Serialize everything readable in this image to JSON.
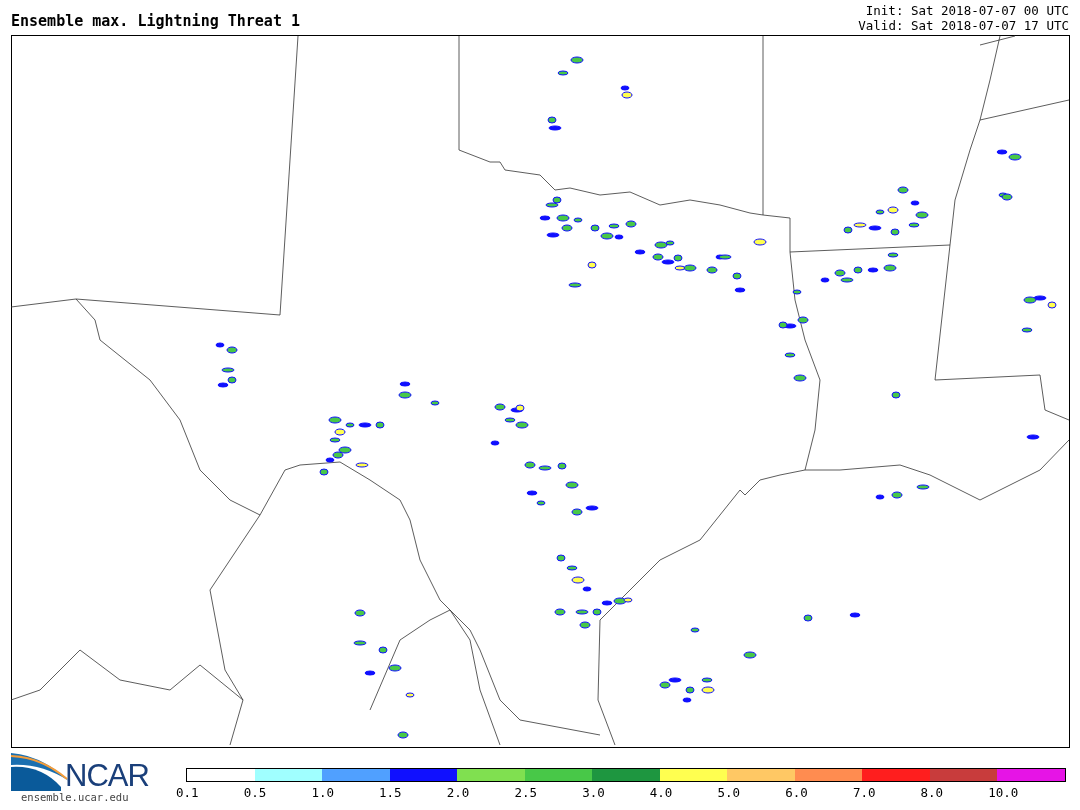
{
  "title": "Ensemble max. Lightning Threat 1",
  "init": "Init: Sat 2018-07-07 00 UTC",
  "valid": "Valid: Sat 2018-07-07 17 UTC",
  "logo": {
    "name": "NCAR",
    "url": "ensemble.ucar.edu"
  },
  "colorbar": [
    {
      "label": "0.1",
      "color": "#ffffff"
    },
    {
      "label": "0.5",
      "color": "#a0ffff"
    },
    {
      "label": "1.0",
      "color": "#50a0ff"
    },
    {
      "label": "1.5",
      "color": "#1010ff"
    },
    {
      "label": "2.0",
      "color": "#80e050"
    },
    {
      "label": "2.5",
      "color": "#48c848"
    },
    {
      "label": "3.0",
      "color": "#1e9640"
    },
    {
      "label": "4.0",
      "color": "#ffff50"
    },
    {
      "label": "5.0",
      "color": "#ffc864"
    },
    {
      "label": "6.0",
      "color": "#ff8c50"
    },
    {
      "label": "7.0",
      "color": "#ff1e1e"
    },
    {
      "label": "8.0",
      "color": "#c83c3c"
    },
    {
      "label": "10.0",
      "color": "#e614e6"
    }
  ]
}
